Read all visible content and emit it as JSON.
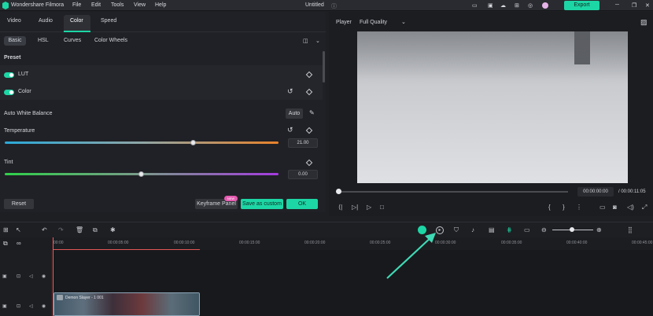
{
  "app": {
    "name": "Wondershare Filmora",
    "doc_title": "Untitled"
  },
  "menu": [
    "File",
    "Edit",
    "Tools",
    "View",
    "Help"
  ],
  "export_label": "Export",
  "tabs": [
    "Video",
    "Audio",
    "Color",
    "Speed"
  ],
  "subtabs": [
    "Basic",
    "HSL",
    "Curves",
    "Color Wheels"
  ],
  "preset": {
    "title": "Preset",
    "lut_label": "LUT",
    "color_label": "Color"
  },
  "awb": {
    "label": "Auto White Balance",
    "auto_label": "Auto"
  },
  "temperature": {
    "label": "Temperature",
    "value": "21.00",
    "level": 0.69
  },
  "tint": {
    "label": "Tint",
    "value": "0.00",
    "level": 0.5
  },
  "footer": {
    "reset": "Reset",
    "keyframe": "Keyframe Panel",
    "new_badge": "NEW",
    "save_custom": "Save as custom",
    "ok": "OK"
  },
  "player": {
    "label": "Player",
    "quality": "Full Quality",
    "current_time": "00:00:00:00",
    "total_time": "/ 00:00:11:05"
  },
  "ruler": [
    "00:00",
    "00:00:05:00",
    "00:00:10:00",
    "00:00:15:00",
    "00:00:20:00",
    "00:00:25:00",
    "00:00:30:00",
    "00:00:35:00",
    "00:00:40:00",
    "00:00:45:00"
  ],
  "clip": {
    "title": "Demon Slayer - 1 001"
  },
  "colors": {
    "accent": "#1dd6a5",
    "playhead": "#ff5a5a"
  }
}
